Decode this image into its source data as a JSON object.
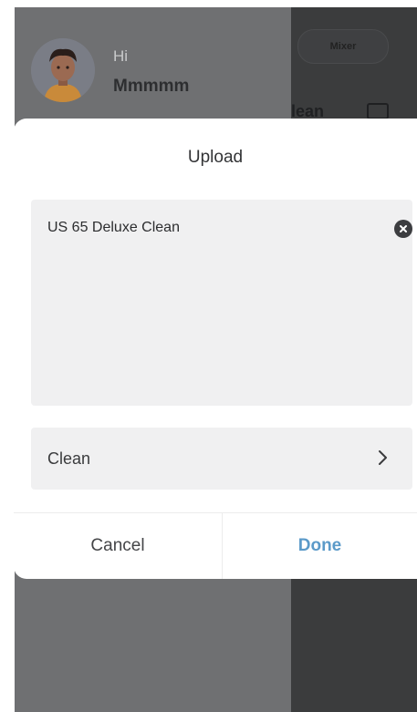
{
  "background": {
    "greeting": "Hi",
    "user_name": "Mmmmm",
    "mixer_button": "Mixer",
    "peek_text": "lean"
  },
  "dialog": {
    "title": "Upload",
    "name_value": "US 65 Deluxe Clean",
    "category_value": "Clean",
    "cancel_label": "Cancel",
    "done_label": "Done"
  },
  "icons": {
    "clear": "clear-icon",
    "chevron": "chevron-right-icon",
    "avatar": "avatar"
  },
  "colors": {
    "accent": "#5b9ac9",
    "overlay_light": "#6f7072",
    "overlay_dark": "#3b3c3d"
  }
}
